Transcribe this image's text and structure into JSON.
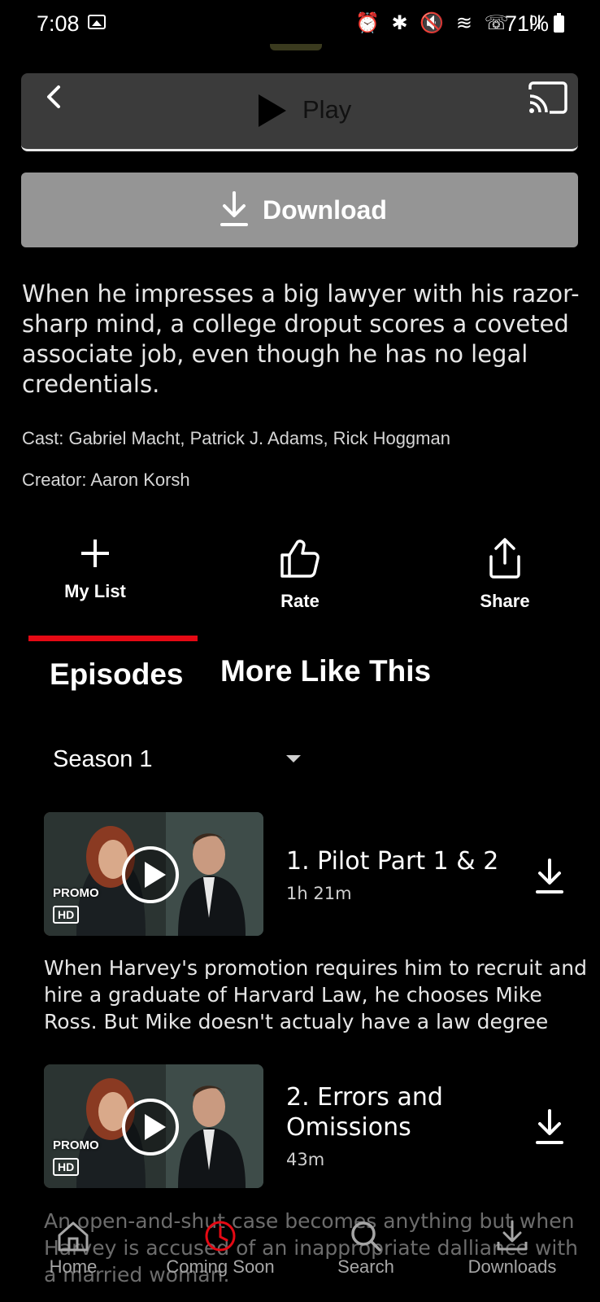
{
  "status_bar": {
    "time": "7:08",
    "indicators": "⏰ ✱ 🔇 ≋ ☏ ıll",
    "battery": "71%"
  },
  "player": {
    "play_label": "Play"
  },
  "download": {
    "label": "Download"
  },
  "details": {
    "synopsis": "When he impresses a big lawyer with his razor-sharp mind, a college droput scores a coveted associate job, even though he has no legal credentials.",
    "cast": "Cast: Gabriel Macht, Patrick J. Adams, Rick Hoggman",
    "creator": "Creator: Aaron Korsh"
  },
  "actions": {
    "my_list": "My List",
    "rate": "Rate",
    "share": "Share"
  },
  "tabs": {
    "episodes": "Episodes",
    "more_like_this": "More Like This",
    "active": "Episodes"
  },
  "season": {
    "selected": "Season 1"
  },
  "episodes": [
    {
      "title": "1. Pilot Part 1 & 2",
      "duration": "1h 21m",
      "promo": "PROMO",
      "hd": "HD",
      "description": "When Harvey's promotion requires him to recruit and hire a graduate of Harvard Law, he chooses Mike Ross. But Mike doesn't actualy have a law degree"
    },
    {
      "title": "2. Errors and Omissions",
      "duration": "43m",
      "promo": "PROMO",
      "hd": "HD",
      "description": "An open-and-shut case becomes anything but when Harvey is accused of an inappropriate dalliance with a married woman."
    }
  ],
  "bottom_nav": {
    "home": "Home",
    "coming_soon": "Coming Soon",
    "search": "Search",
    "downloads": "Downloads"
  },
  "colors": {
    "accent": "#e50914",
    "background": "#000000",
    "play_bar": "#3b3b3b",
    "download_button": "#959595"
  }
}
